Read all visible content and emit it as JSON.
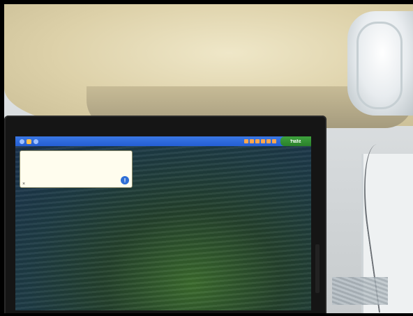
{
  "taskbar": {
    "clock": "",
    "start_label": "start"
  },
  "balloon": {
    "title": "",
    "body": "",
    "close_glyph": "×",
    "info_glyph": "i"
  },
  "icons": {
    "tray": [
      "network-icon",
      "volume-icon",
      "security-icon"
    ],
    "quicklaunch": [
      "ie-icon",
      "mail-icon",
      "media-icon",
      "folder-icon",
      "app-icon",
      "app-icon"
    ]
  },
  "colors": {
    "taskbar_blue": "#245ed3",
    "start_green": "#2a7f2a",
    "balloon_bg": "#fffdee"
  }
}
